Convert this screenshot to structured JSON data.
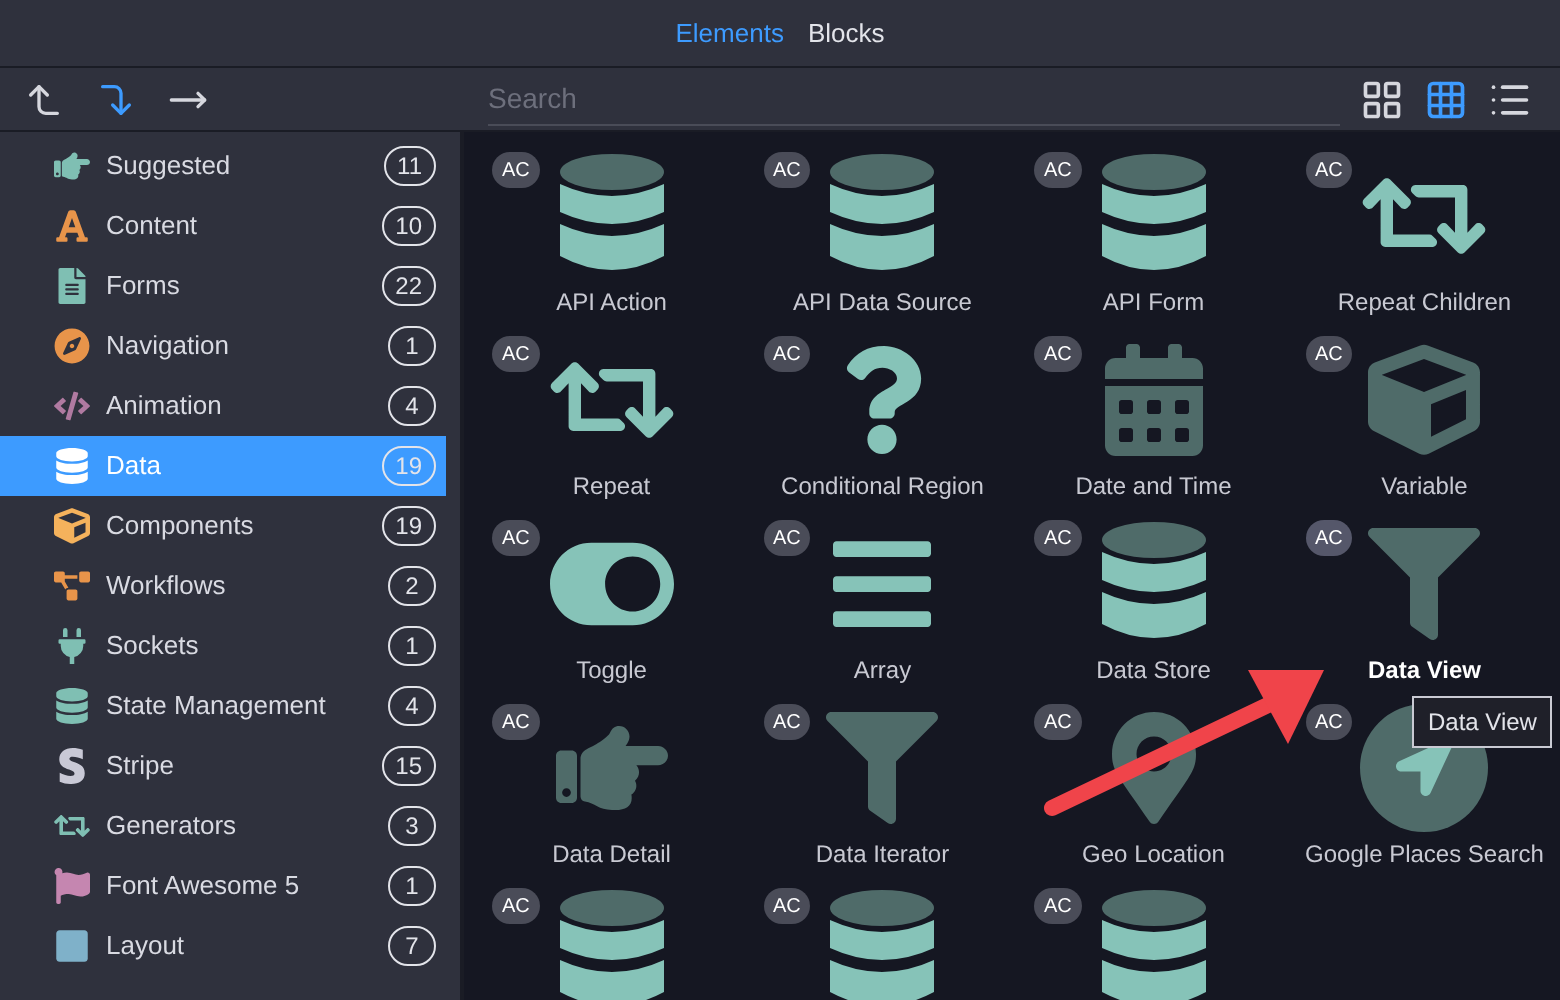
{
  "tabs": [
    {
      "label": "Elements",
      "selected": true
    },
    {
      "label": "Blocks",
      "selected": false
    }
  ],
  "toolbar": {
    "tools": [
      {
        "kind": "up",
        "selected": false
      },
      {
        "kind": "down",
        "selected": true
      },
      {
        "kind": "right",
        "selected": false
      }
    ],
    "search": {
      "placeholder": "Search"
    },
    "views": [
      {
        "kind": "large",
        "selected": false
      },
      {
        "kind": "grid",
        "selected": true
      },
      {
        "kind": "list",
        "selected": false
      }
    ]
  },
  "sidebar": {
    "items": [
      {
        "label": "Suggested",
        "count": "11",
        "kind": "hand",
        "color": "#7fbfb3",
        "selected": false
      },
      {
        "label": "Content",
        "count": "10",
        "kind": "font",
        "color": "#e8944a",
        "selected": false
      },
      {
        "label": "Forms",
        "count": "22",
        "kind": "file",
        "color": "#7fbfb3",
        "selected": false
      },
      {
        "label": "Navigation",
        "count": "1",
        "kind": "compass",
        "color": "#e8944a",
        "selected": false
      },
      {
        "label": "Animation",
        "count": "4",
        "kind": "code",
        "color": "#b07aa1",
        "selected": false
      },
      {
        "label": "Data",
        "count": "19",
        "kind": "database",
        "color": "#ffffff",
        "selected": true
      },
      {
        "label": "Components",
        "count": "19",
        "kind": "cube",
        "color": "#f5b25c",
        "selected": false
      },
      {
        "label": "Workflows",
        "count": "2",
        "kind": "diagram",
        "color": "#e8944a",
        "selected": false
      },
      {
        "label": "Sockets",
        "count": "1",
        "kind": "plug",
        "color": "#7fbfb3",
        "selected": false
      },
      {
        "label": "State Management",
        "count": "4",
        "kind": "database",
        "color": "#7fbfb3",
        "selected": false
      },
      {
        "label": "Stripe",
        "count": "15",
        "kind": "stripe",
        "color": "#c9c9d6",
        "selected": false
      },
      {
        "label": "Generators",
        "count": "3",
        "kind": "repeat",
        "color": "#7fbfb3",
        "selected": false
      },
      {
        "label": "Font Awesome 5",
        "count": "1",
        "kind": "flag",
        "color": "#c586b0",
        "selected": false
      },
      {
        "label": "Layout",
        "count": "7",
        "kind": "square",
        "color": "#7fb1c9",
        "selected": false
      }
    ]
  },
  "elements": [
    {
      "badge": "AC",
      "label": "API Action",
      "kind": "database",
      "hovered": false
    },
    {
      "badge": "AC",
      "label": "API Data Source",
      "kind": "database",
      "hovered": false
    },
    {
      "badge": "AC",
      "label": "API Form",
      "kind": "database",
      "hovered": false
    },
    {
      "badge": "AC",
      "label": "Repeat Children",
      "kind": "repeat",
      "hovered": false
    },
    {
      "badge": "AC",
      "label": "Repeat",
      "kind": "repeat",
      "hovered": false
    },
    {
      "badge": "AC",
      "label": "Conditional Region",
      "kind": "question",
      "hovered": false
    },
    {
      "badge": "AC",
      "label": "Date and Time",
      "kind": "calendar",
      "hovered": false
    },
    {
      "badge": "AC",
      "label": "Variable",
      "kind": "cube",
      "hovered": false
    },
    {
      "badge": "AC",
      "label": "Toggle",
      "kind": "toggle",
      "hovered": false
    },
    {
      "badge": "AC",
      "label": "Array",
      "kind": "bars",
      "hovered": false
    },
    {
      "badge": "AC",
      "label": "Data Store",
      "kind": "database",
      "hovered": false
    },
    {
      "badge": "AC",
      "label": "Data View",
      "kind": "funnel",
      "hovered": true
    },
    {
      "badge": "AC",
      "label": "Data Detail",
      "kind": "hand",
      "hovered": false
    },
    {
      "badge": "AC",
      "label": "Data Iterator",
      "kind": "funnel",
      "hovered": false
    },
    {
      "badge": "AC",
      "label": "Geo Location",
      "kind": "pin",
      "hovered": false
    },
    {
      "badge": "AC",
      "label": "Google Places Search",
      "kind": "location",
      "hovered": false
    },
    {
      "badge": "AC",
      "kind": "database",
      "hovered": false
    },
    {
      "badge": "AC",
      "kind": "database",
      "hovered": false
    },
    {
      "badge": "AC",
      "kind": "database",
      "hovered": false
    }
  ],
  "tooltip": {
    "text": "Data View"
  }
}
